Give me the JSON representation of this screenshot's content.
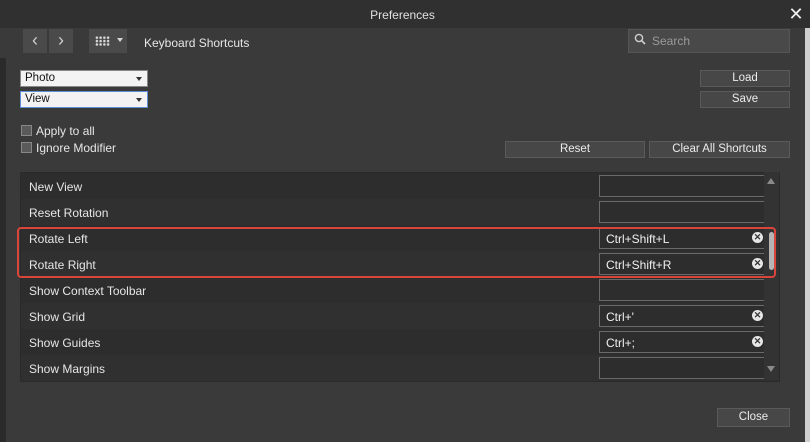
{
  "window": {
    "title": "Preferences",
    "close_glyph": "✕"
  },
  "toolbar": {
    "back_glyph": "‹",
    "forward_glyph": "›",
    "section_title": "Keyboard Shortcuts",
    "search_placeholder": "Search"
  },
  "filters": {
    "category_select": "Photo",
    "context_select": "View"
  },
  "buttons": {
    "load": "Load",
    "save": "Save",
    "reset": "Reset",
    "clear_all": "Clear All Shortcuts",
    "close": "Close"
  },
  "options": {
    "apply_to_all": "Apply to all",
    "ignore_modifier": "Ignore Modifier"
  },
  "shortcuts": [
    {
      "name": "New View",
      "shortcut": ""
    },
    {
      "name": "Reset Rotation",
      "shortcut": ""
    },
    {
      "name": "Rotate Left",
      "shortcut": "Ctrl+Shift+L"
    },
    {
      "name": "Rotate Right",
      "shortcut": "Ctrl+Shift+R"
    },
    {
      "name": "Show Context Toolbar",
      "shortcut": ""
    },
    {
      "name": "Show Grid",
      "shortcut": "Ctrl+'"
    },
    {
      "name": "Show Guides",
      "shortcut": "Ctrl+;"
    },
    {
      "name": "Show Margins",
      "shortcut": ""
    }
  ],
  "clear_glyph": "✕",
  "colors": {
    "highlight": "#d9453a",
    "focus": "#5c8fd6"
  }
}
